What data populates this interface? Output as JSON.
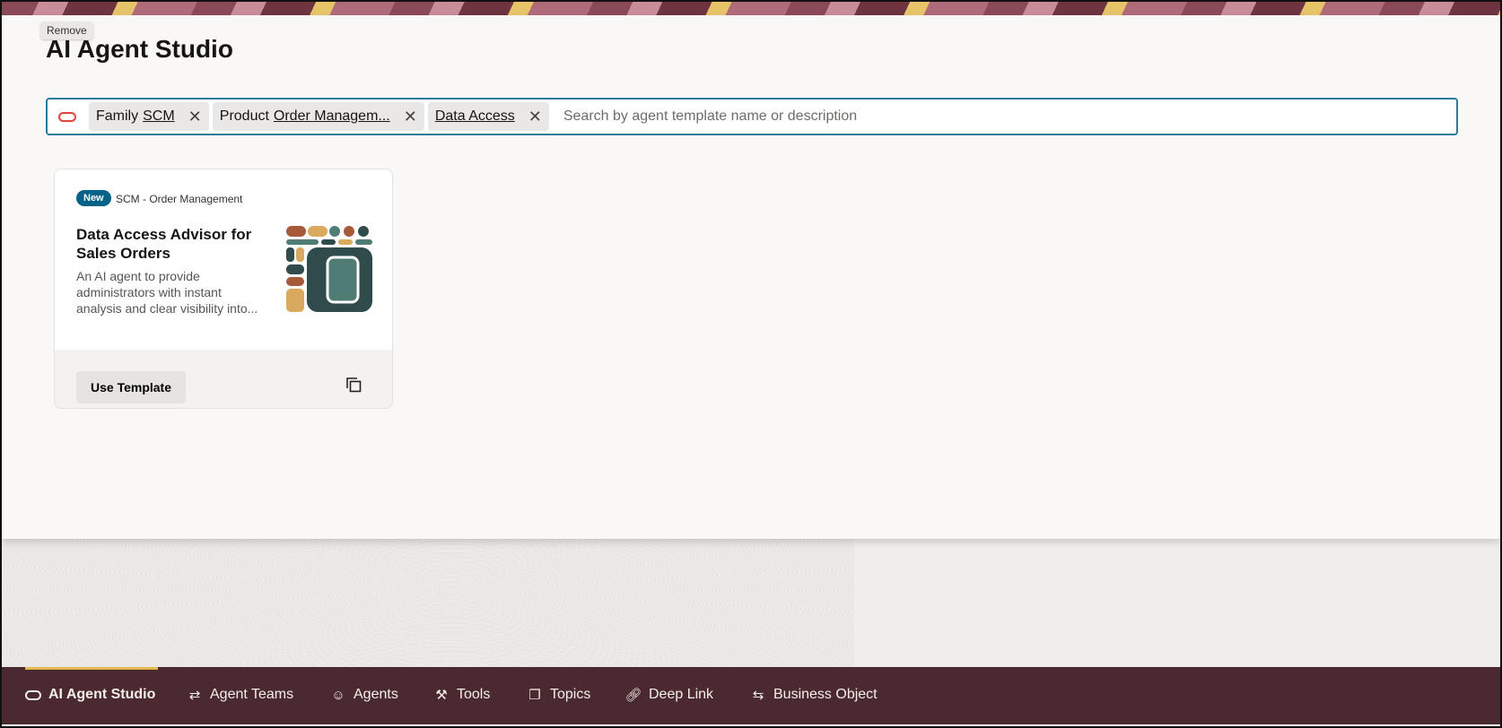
{
  "tooltip": "Remove",
  "page_title": "AI Agent Studio",
  "search": {
    "chips": [
      {
        "label": "Family",
        "value": "SCM"
      },
      {
        "label": "Product",
        "value": "Order Managem..."
      },
      {
        "label": "",
        "value": "Data Access"
      }
    ],
    "placeholder": "Search by agent template name or description"
  },
  "card": {
    "badge": "New",
    "category": "SCM - Order Management",
    "title": "Data Access Advisor for Sales Orders",
    "description": "An AI agent to provide administrators with instant analysis and clear visibility into...",
    "button": "Use Template"
  },
  "nav": {
    "items": [
      {
        "label": "AI Agent Studio",
        "icon": "oracle-logo-icon"
      },
      {
        "label": "Agent Teams",
        "icon": "agent-teams-icon"
      },
      {
        "label": "Agents",
        "icon": "agent-icon"
      },
      {
        "label": "Tools",
        "icon": "tools-icon"
      },
      {
        "label": "Topics",
        "icon": "topics-icon"
      },
      {
        "label": "Deep Link",
        "icon": "link-icon"
      },
      {
        "label": "Business Object",
        "icon": "business-object-icon"
      }
    ]
  },
  "colors": {
    "accent": "#2f7a98",
    "nav_bg": "#4b2930",
    "badge": "#05638a",
    "active_underline": "#e3b94e"
  }
}
